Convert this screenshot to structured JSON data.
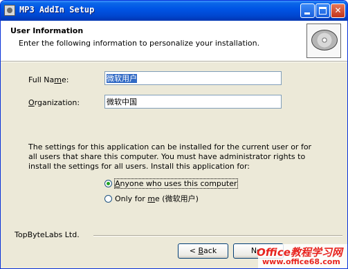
{
  "window": {
    "title": "MP3 AddIn Setup"
  },
  "header": {
    "title": "User Information",
    "subtitle": "Enter the following information to personalize your installation."
  },
  "form": {
    "full_name_label_a": "Full Na",
    "full_name_label_u": "m",
    "full_name_label_b": "e:",
    "full_name_value": "微软用户",
    "org_label_u": "O",
    "org_label_b": "rganization:",
    "org_value": "微软中国"
  },
  "install_text": "The settings for this application can be installed for the current user or for all users that share this computer. You must have administrator rights to install the settings for all users. Install this application for:",
  "options": {
    "anyone_u": "A",
    "anyone_b": "nyone who uses this computer",
    "only_a": "Only for ",
    "only_u": "m",
    "only_b": "e (微软用户)",
    "selected": "anyone"
  },
  "footer": {
    "brand": "TopByteLabs Ltd.",
    "back_a": "< ",
    "back_u": "B",
    "back_b": "ack",
    "next_visible": "Nex"
  },
  "watermark": {
    "line1": "Office教程学习网",
    "line2": "www.office68.com"
  },
  "colors": {
    "titlebar": "#0055E5",
    "dialog_bg": "#ECE9D8",
    "selection": "#316AC5",
    "radio_dot": "#21A121",
    "watermark": "#E8231E"
  }
}
